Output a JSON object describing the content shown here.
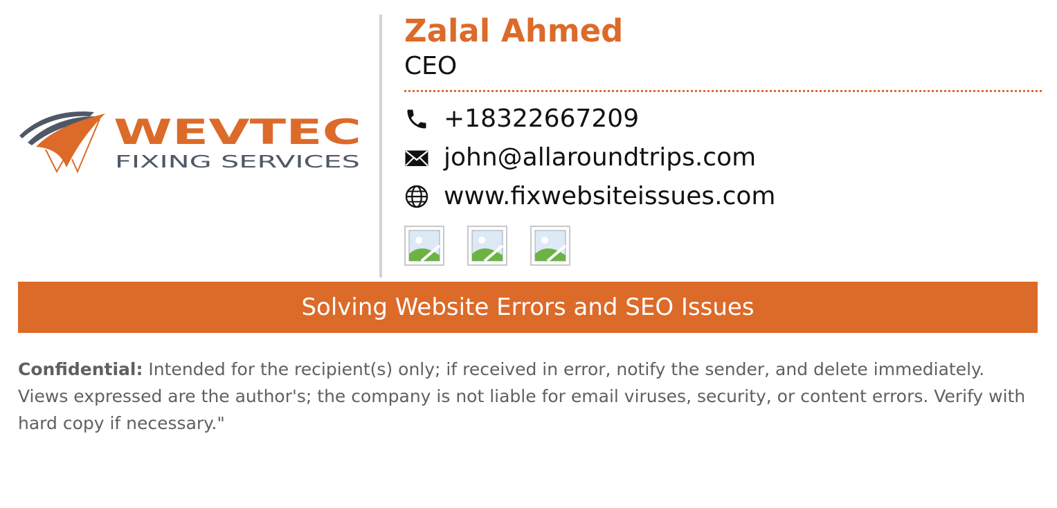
{
  "colors": {
    "accent": "#dc6a29",
    "logo_gray": "#4f5866",
    "divider": "#d3d3d3",
    "text": "#111111",
    "disclaimer_text": "#606060"
  },
  "logo": {
    "wordmark": "WEVTEC",
    "tagline": "FIXING SERVICES",
    "icon": "swoosh-logo-icon"
  },
  "person": {
    "name": "Zalal Ahmed",
    "title": "CEO"
  },
  "contact": {
    "phone": {
      "icon": "phone-icon",
      "value": "+18322667209"
    },
    "email": {
      "icon": "envelope-icon",
      "value": "john@allaroundtrips.com"
    },
    "website": {
      "icon": "globe-icon",
      "value": "www.fixwebsiteissues.com"
    }
  },
  "social_links": [
    {
      "icon": "broken-image-icon"
    },
    {
      "icon": "broken-image-icon"
    },
    {
      "icon": "broken-image-icon"
    }
  ],
  "banner": {
    "text": "Solving Website Errors and SEO Issues"
  },
  "disclaimer": {
    "label": "Confidential:",
    "text": " Intended for the recipient(s) only; if received in error, notify the sender, and delete immediately. Views expressed are the author's; the company is not liable for email viruses, security, or content errors. Verify with hard copy if necessary.\""
  }
}
